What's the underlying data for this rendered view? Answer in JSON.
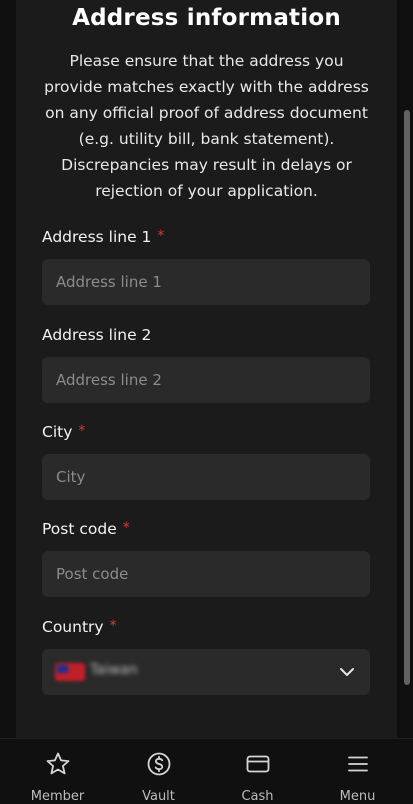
{
  "form": {
    "title": "Address information",
    "description": "Please ensure that the address you provide matches exactly with the address on any official proof of address document (e.g. utility bill, bank statement). Discrepancies may result in delays or rejection of your application.",
    "required_marker": "*",
    "address_line_1": {
      "label": "Address line 1",
      "placeholder": "Address line 1",
      "value": ""
    },
    "address_line_2": {
      "label": "Address line 2",
      "placeholder": "Address line 2",
      "value": ""
    },
    "city": {
      "label": "City",
      "placeholder": "City",
      "value": ""
    },
    "post_code": {
      "label": "Post code",
      "placeholder": "Post code",
      "value": ""
    },
    "country": {
      "label": "Country",
      "selected": "Taiwan"
    }
  },
  "bottom_nav": [
    {
      "label": "Member",
      "icon": "star-icon"
    },
    {
      "label": "Vault",
      "icon": "dollar-circle-icon"
    },
    {
      "label": "Cash",
      "icon": "card-icon"
    },
    {
      "label": "Menu",
      "icon": "hamburger-menu-icon"
    }
  ],
  "colors": {
    "background": "#0f0f0f",
    "panel": "#1b1b1b",
    "field": "#2a2a2a",
    "required": "#d43a3a"
  }
}
